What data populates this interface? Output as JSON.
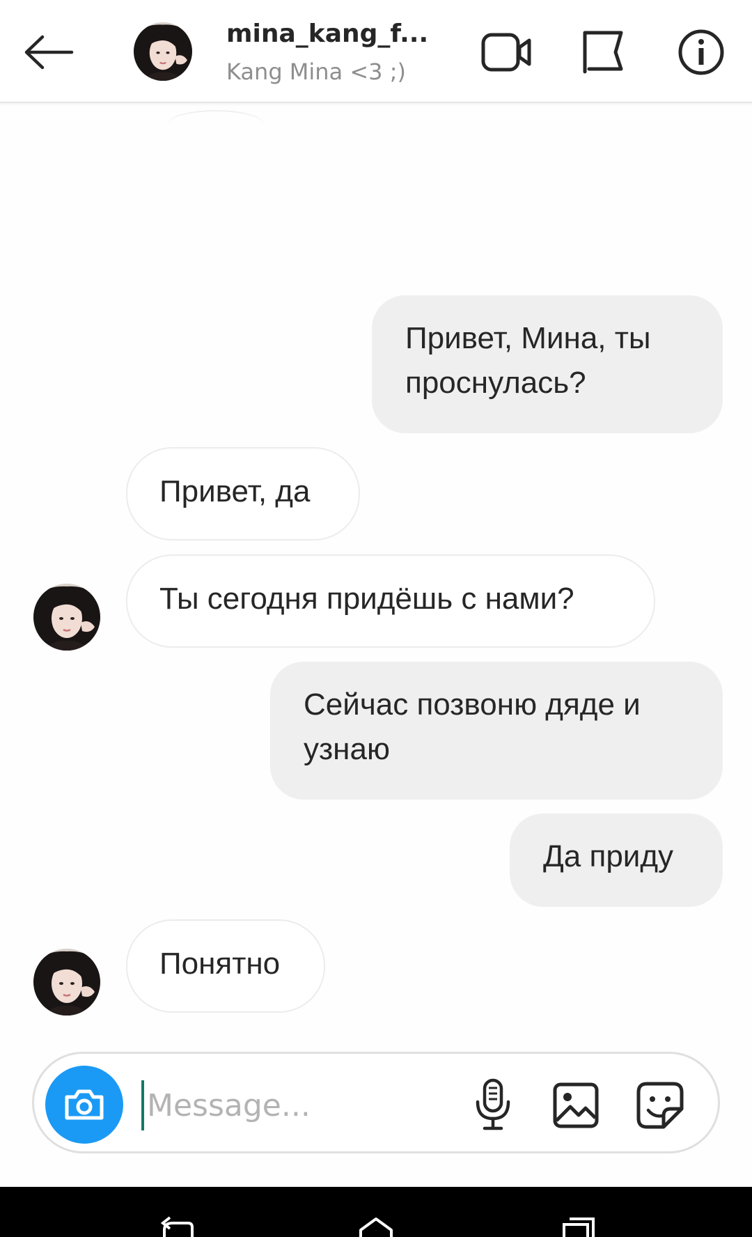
{
  "header": {
    "username": "mina_kang_f...",
    "subtitle": "Kang Mina <3 ;)",
    "icons": [
      "back-arrow-icon",
      "avatar",
      "video-call-icon",
      "flag-icon",
      "info-icon"
    ]
  },
  "messages": [
    {
      "direction": "outgoing",
      "text": "Привет, Мина, ты проснулась?"
    },
    {
      "direction": "incoming",
      "text": "Привет, да"
    },
    {
      "direction": "incoming",
      "text": "Ты сегодня придёшь с нами?"
    },
    {
      "direction": "outgoing",
      "text": "Сейчас позвоню дяде и узнаю"
    },
    {
      "direction": "outgoing",
      "text": "Да приду"
    },
    {
      "direction": "incoming",
      "text": "Понятно"
    }
  ],
  "composer": {
    "placeholder": "Message...",
    "value": "",
    "icons": [
      "camera-icon",
      "microphone-icon",
      "gallery-icon",
      "sticker-icon"
    ]
  },
  "system_nav": {
    "icons": [
      "back-icon",
      "home-icon",
      "recents-icon"
    ]
  },
  "colors": {
    "outgoing_bubble": "#efeff0",
    "incoming_border": "#ececec",
    "camera_button": "#1a9af5",
    "subtitle_text": "#8e8e8e",
    "placeholder_text": "#b3b3b3",
    "cursor": "#127a67"
  }
}
